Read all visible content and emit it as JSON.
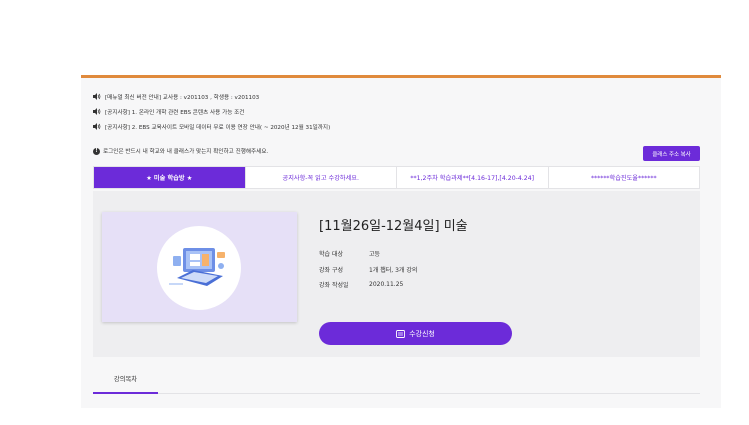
{
  "notices": [
    "[매뉴얼 최신 버전 안내] 교사용 : v201103 , 학생용 : v201103",
    "[공지사항] 1. 온라인 개학 관련 EBS 콘텐츠 사용 가능 조건",
    "[공지사항] 2. EBS 교육사이트 모바일 데이터 무료 이용 연장 안내( ~ 2020년 12월 31일까지)"
  ],
  "warning": "로그인은 반드시 내 학교와 내 클래스가 맞는지 확인하고 진행해주세요.",
  "copy_button": "클래스 주소 복사",
  "tabs": [
    "★ 미술 학습방 ★",
    "공지사항-꼭 읽고 수강하세요.",
    "**1,2주차 학습과제**[4.16-17],[4.20-4.24]",
    "******학습진도율******"
  ],
  "course": {
    "title": "[11월26일-12월4일] 미술",
    "meta": [
      {
        "label": "학습 대상",
        "value": "고등"
      },
      {
        "label": "강좌 구성",
        "value": "1개 챕터, 3개 강의"
      },
      {
        "label": "강좌 작성일",
        "value": "2020.11.25"
      }
    ],
    "enroll_label": "수강신청"
  },
  "toc_tab": "강의목차",
  "colors": {
    "accent": "#6c2bd9",
    "top_border": "#e08a3c"
  }
}
